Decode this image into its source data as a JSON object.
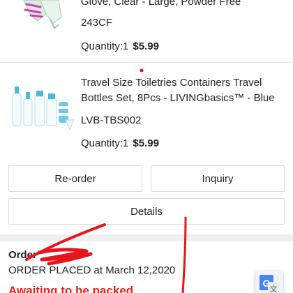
{
  "items": [
    {
      "title": "Glove, Clear - Large, Powder Free",
      "sku": "243CF",
      "quantity": "Quantity:1",
      "price": "$5.99"
    },
    {
      "title": "Travel Size Toiletries Containers Travel Bottles Set, 8Pcs - LIVINGbasics™ - Blue",
      "sku": "LVB-TBS002",
      "quantity": "Quantity:1",
      "price": "$5.99"
    }
  ],
  "actions": {
    "reorder": "Re-order",
    "inquiry": "Inquiry",
    "details": "Details"
  },
  "order": {
    "label": "Order",
    "placed": "ORDER PLACED at March 12,2020",
    "status": "Awaiting to be packed"
  },
  "colors": {
    "accent": "#e1251b",
    "annotation": "#e8141c"
  },
  "icons": {
    "translate": "google-translate-icon"
  }
}
